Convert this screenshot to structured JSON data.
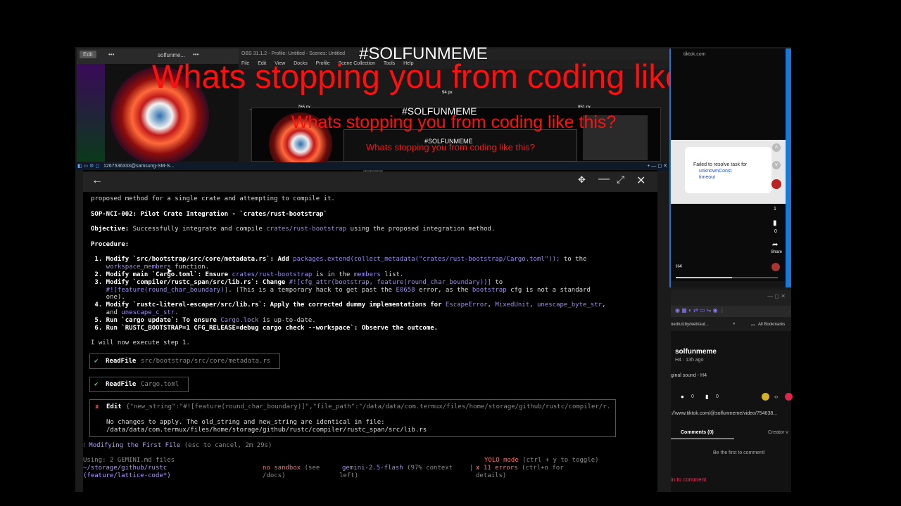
{
  "stream_overlay": {
    "hashtag": "#SOLFUNMEME",
    "headline": "Whats stopping you from coding like this?"
  },
  "background": {
    "left_tab": {
      "edit": "Edit",
      "dots": "•••",
      "title": "solfunme...",
      "dots2": "•••"
    },
    "obs": {
      "title": "OBS 31.1.2 - Profile: Untitled - Scenes: Untitled",
      "menu": [
        "File",
        "Edit",
        "View",
        "Docks",
        "Profile",
        "Scene Collection",
        "Tools",
        "Help"
      ],
      "px_labels": [
        "94 px",
        "765 px",
        "851 px"
      ]
    },
    "taskbar_text": "1267536333@samsung-SM-S..."
  },
  "phone": {
    "title": "tiktok.com",
    "toast": {
      "line1": "Failed to resolve task for",
      "line2": "unknownConst",
      "line3": "timeout"
    },
    "likes": "1",
    "saves": "0",
    "share": "Share",
    "tag": "H4"
  },
  "browser": {
    "url_short": "oedruizby/web/aut...",
    "bookmarks": "All Bookmarks",
    "author": "solfunmeme",
    "meta": "H4 · 13h ago",
    "sound": "ginal sound - H4",
    "count1": "0",
    "count2": "0",
    "url": "://www.tiktok.com/@solfunmeme/video/754638...",
    "comments_tab": "Comments (0)",
    "creator_tab": "Creator v",
    "first_comment": "Be the first to comment!",
    "login": "in to comment"
  },
  "terminal": {
    "intro": "proposed method for a single crate and attempting to compile it.",
    "sop_title": "SOP-NCI-002: Pilot Crate Integration - `crates/rust-bootstrap`",
    "objective_label": "Objective:",
    "objective_text": " Successfully integrate and compile ",
    "objective_crate": "crates/rust-bootstrap",
    "objective_tail": " using the proposed integration method.",
    "procedure": "Procedure:",
    "steps": {
      "s1a": " 1. Modify `src/bootstrap/src/core/metadata.rs`: Add ",
      "s1b": "packages.extend(collect_metadata(\"crates/rust-bootstrap/Cargo.toml\"));",
      "s1c": " to the",
      "s1d": "    workspace_members",
      "s1e": " function.",
      "s2a": " 2. Modify main `Cargo.toml`: Ensure ",
      "s2b": "crates/rust-bootstrap",
      "s2c": " is in the ",
      "s2d": "members",
      "s2e": " list.",
      "s3a": " 3. Modify `compiler/rustc_span/src/lib.rs`: Change ",
      "s3b": "#![cfg_attr(bootstrap, feature(round_char_boundary))]",
      "s3c": " to",
      "s3d": "    #![feature(round_char_boundary)]",
      "s3e": ". (This is a temporary hack to get past the ",
      "s3f": "E0658",
      "s3g": " error, as the ",
      "s3h": "bootstrap",
      "s3i": " cfg is not a standard",
      "s3j": "    one).",
      "s4a": " 4. Modify `rustc-literal-escaper/src/lib.rs`: Apply the corrected dummy implementations for ",
      "s4b": "EscapeError",
      "s4c": ", ",
      "s4d": "MixedUnit",
      "s4e": ", ",
      "s4f": "unescape_byte_str",
      "s4g": ",",
      "s4h": "    and ",
      "s4i": "unescape_c_str",
      "s4j": ".",
      "s5a": " 5. Run `cargo update`: To ensure ",
      "s5b": "Cargo.lock",
      "s5c": " is up-to-date.",
      "s6": " 6. Run `RUSTC_BOOTSTRAP=1 CFG_RELEASE=debug cargo check --workspace`: Observe the outcome."
    },
    "execute": "I will now execute step 1.",
    "tool1": {
      "icon": "✔",
      "name": "ReadFile",
      "path": "src/bootstrap/src/core/metadata.rs"
    },
    "tool2": {
      "icon": "✔",
      "name": "ReadFile",
      "path": "Cargo.toml"
    },
    "tool3": {
      "icon": "x",
      "name": "Edit",
      "args": "{\"new_string\":\"#![feature(round_char_boundary)]\",\"file_path\":\"/data/data/com.termux/files/home/storage/github/rustc/compiler/r...",
      "msg1": "No changes to apply. The old_string and new_string are identical in file:",
      "msg2": "/data/data/com.termux/files/home/storage/github/rustc/compiler/rustc_span/src/lib.rs"
    },
    "status_spinner": "⁝",
    "status": " Modifying the First File",
    "status_hint": " (esc to cancel, 2m 29s)",
    "footer": {
      "using": "Using: 2 GEMINI.md files",
      "path": "~/storage/github/rustc",
      "branch": "(feature/lattice-code*)",
      "sandbox1": "no sandbox",
      "sandbox_see": " (see",
      "sandbox2": "/docs)",
      "model": "gemini-2.5-flash",
      "context": " (97% context",
      "left": "left)",
      "sep": "|",
      "yolo": "YOLO mode",
      "yolo_hint": " (ctrl + y to toggle)",
      "errors_x": "x",
      "errors": " 11 errors",
      "errors_hint": " (ctrl+o for",
      "details": "details)"
    }
  },
  "colors": {
    "accent_purple": "#9a8cf0",
    "ok_green": "#6fd36f",
    "error_red": "#ff5b5b",
    "overlay_red": "#ff1010",
    "window_blue": "#1a78d8"
  }
}
